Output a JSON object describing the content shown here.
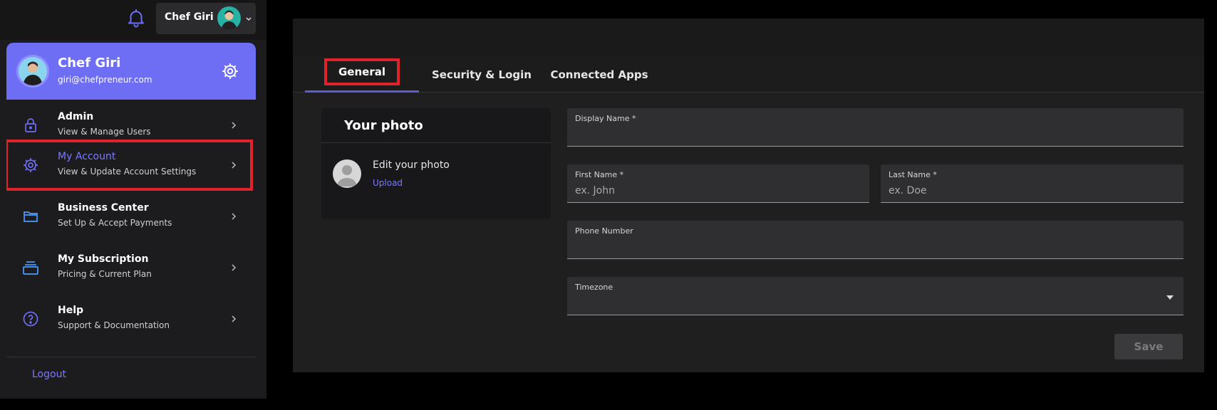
{
  "topbar": {
    "user_name": "Chef Giri",
    "icons": {
      "bell": "bell-icon",
      "chevron": "chevron-down-icon"
    }
  },
  "menu": {
    "header": {
      "name": "Chef Giri",
      "email": "giri@chefpreneur.com",
      "settings_icon": "gear-icon"
    },
    "items": [
      {
        "title": "Admin",
        "subtitle": "View & Manage Users",
        "icon": "lock-icon"
      },
      {
        "title": "My Account",
        "subtitle": "View & Update Account Settings",
        "icon": "gear-icon",
        "active": true
      },
      {
        "title": "Business Center",
        "subtitle": "Set Up & Accept Payments",
        "icon": "folder-icon"
      },
      {
        "title": "My Subscription",
        "subtitle": "Pricing & Current Plan",
        "icon": "stack-icon"
      },
      {
        "title": "Help",
        "subtitle": "Support & Documentation",
        "icon": "help-icon"
      }
    ],
    "logout_label": "Logout"
  },
  "settings": {
    "tabs": [
      {
        "label": "General",
        "active": true
      },
      {
        "label": "Security & Login"
      },
      {
        "label": "Connected Apps"
      }
    ],
    "photo_card": {
      "title": "Your photo",
      "edit_label": "Edit your photo",
      "upload_label": "Upload"
    },
    "fields": {
      "display_name": {
        "label": "Display Name *",
        "value": "",
        "placeholder": ""
      },
      "first_name": {
        "label": "First Name *",
        "value": "",
        "placeholder": "ex. John"
      },
      "last_name": {
        "label": "Last Name *",
        "value": "",
        "placeholder": "ex. Doe"
      },
      "phone": {
        "label": "Phone Number",
        "value": "",
        "placeholder": ""
      },
      "timezone": {
        "label": "Timezone",
        "value": ""
      }
    },
    "save_label": "Save"
  },
  "colors": {
    "accent": "#6e6ef4",
    "link": "#7a7aff",
    "highlight": "#e0232a",
    "panel": "#1f1f20"
  }
}
